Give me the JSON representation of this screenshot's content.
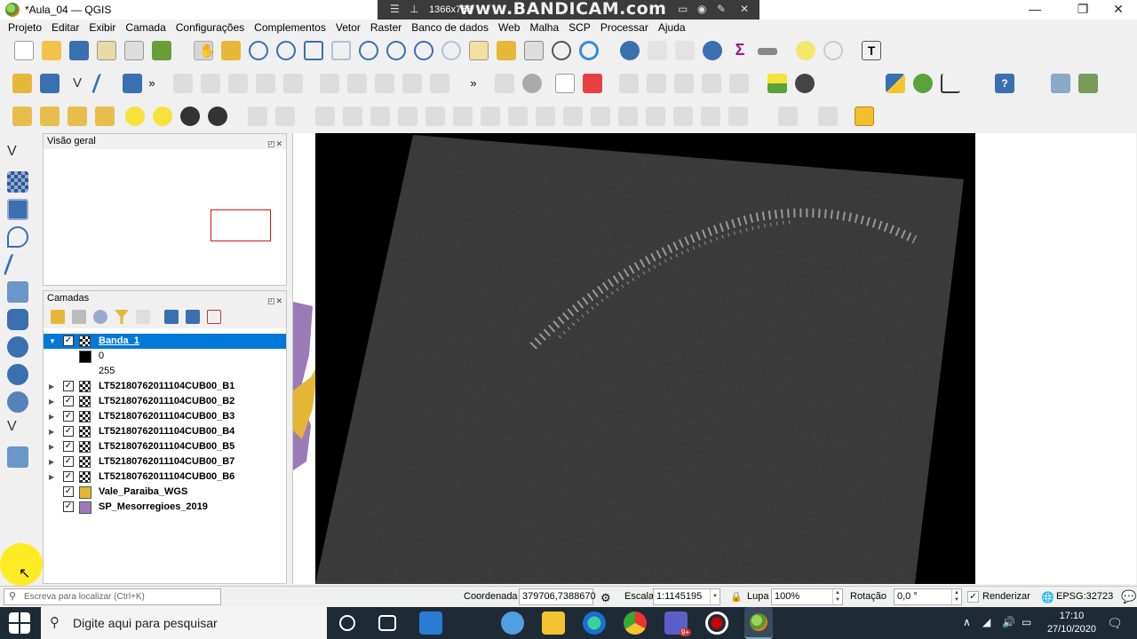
{
  "window": {
    "title": "*Aula_04 — QGIS",
    "minimize": "—",
    "maximize": "❐",
    "close": "✕"
  },
  "recorder": {
    "resolution": "1366x768",
    "watermark": "www.BANDICAM.com"
  },
  "menu": [
    "Projeto",
    "Editar",
    "Exibir",
    "Camada",
    "Configurações",
    "Complementos",
    "Vetor",
    "Raster",
    "Banco de dados",
    "Web",
    "Malha",
    "SCP",
    "Processar",
    "Ajuda"
  ],
  "overview_panel": {
    "title": "Visão geral",
    "buttons": "◰✕"
  },
  "layers_panel": {
    "title": "Camadas",
    "buttons": "◰✕",
    "layers": [
      {
        "name": "Banda_1",
        "kind": "raster",
        "selected": true,
        "expanded": true,
        "checked": true
      },
      {
        "legend": "0",
        "color": "#000000"
      },
      {
        "legend": "255",
        "color": "#ffffff"
      },
      {
        "name": "LT52180762011104CUB00_B1",
        "kind": "raster",
        "checked": true
      },
      {
        "name": "LT52180762011104CUB00_B2",
        "kind": "raster",
        "checked": true
      },
      {
        "name": "LT52180762011104CUB00_B3",
        "kind": "raster",
        "checked": true
      },
      {
        "name": "LT52180762011104CUB00_B4",
        "kind": "raster",
        "checked": true
      },
      {
        "name": "LT52180762011104CUB00_B5",
        "kind": "raster",
        "checked": true
      },
      {
        "name": "LT52180762011104CUB00_B7",
        "kind": "raster",
        "checked": true
      },
      {
        "name": "LT52180762011104CUB00_B6",
        "kind": "raster",
        "checked": true
      },
      {
        "name": "Vale_Paraiba_WGS",
        "kind": "vector",
        "color": "#e5b636",
        "checked": true
      },
      {
        "name": "SP_Mesorregioes_2019",
        "kind": "vector",
        "color": "#9b7bb5",
        "checked": true
      }
    ]
  },
  "status": {
    "search_placeholder": "Escreva para localizar (Ctrl+K)",
    "coord_label": "Coordenada",
    "coord_value": "379706,7388670",
    "scale_label": "Escala",
    "scale_value": "1:1145195",
    "magnifier_label": "Lupa",
    "magnifier_value": "100%",
    "rotation_label": "Rotação",
    "rotation_value": "0,0 °",
    "render_label": "Renderizar",
    "crs": "EPSG:32723"
  },
  "taskbar": {
    "search_text": "Digite aqui para pesquisar",
    "time": "17:10",
    "date": "27/10/2020",
    "badge": "9+"
  },
  "colors": {
    "selection": "#0078d7",
    "vale_layer": "#e5b636",
    "meso_layer": "#9b7bb5",
    "image_dark": "#3a3a3a"
  }
}
